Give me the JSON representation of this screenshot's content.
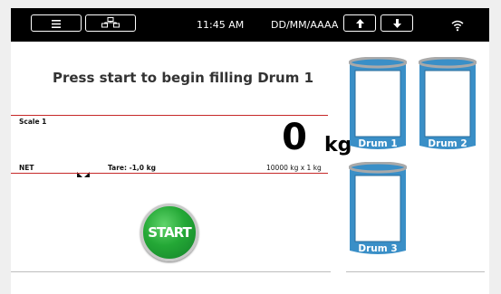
{
  "topbar": {
    "time": "11:45 AM",
    "date": "DD/MM/AAAA"
  },
  "prompt": "Press start to begin filling Drum 1",
  "scale": {
    "name": "Scale 1",
    "mode": "NET",
    "tare": "Tare: -1,0 kg",
    "weight": "0",
    "unit": "kg",
    "capacity": "10000 kg x 1 kg"
  },
  "start_label": "START",
  "drums": [
    {
      "label": "Drum 1"
    },
    {
      "label": "Drum 2"
    },
    {
      "label": "Drum 3"
    }
  ],
  "colors": {
    "drum_blue": "#3a8fc7",
    "drum_rim": "#a9a9a9",
    "start_green": "#24a836",
    "line_red": "#c62828"
  }
}
